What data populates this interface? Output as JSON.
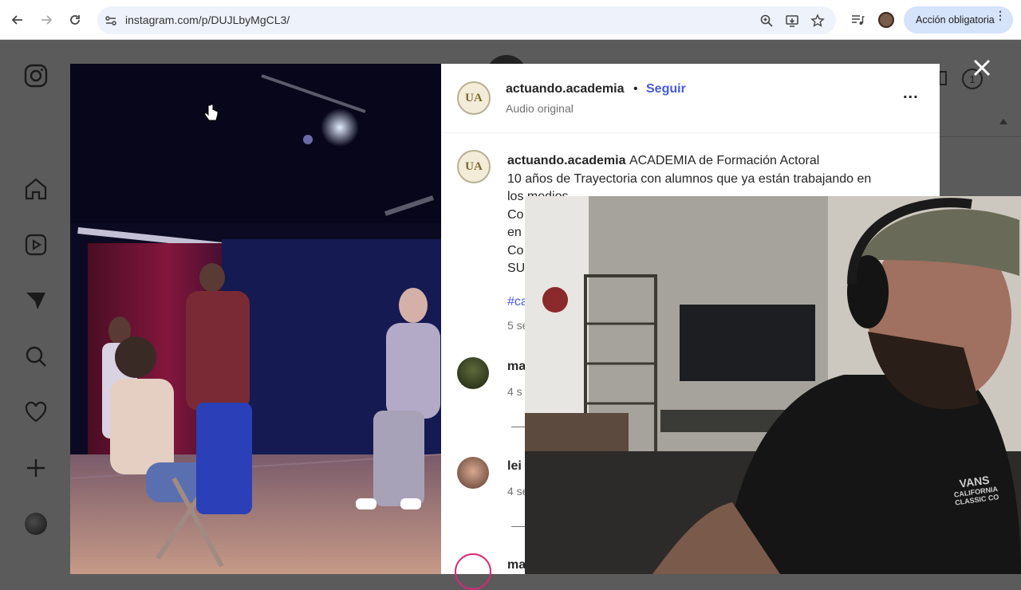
{
  "browser": {
    "url": "instagram.com/p/DUJLbyMgCL3/",
    "action_button": "Acción obligatoria"
  },
  "post": {
    "author": "actuando.academia",
    "separator": "•",
    "follow": "Seguir",
    "audio": "Audio original",
    "more": "...",
    "caption_author": "actuando.academia",
    "caption_line1": "ACADEMIA de Formación Actoral",
    "caption_line2": "10 años de Trayectoria con alumnos que ya están trabajando en",
    "caption_line3": "los medios",
    "caption_frag1": "Co",
    "caption_frag2": "en",
    "caption_frag3": "Co",
    "caption_frag4": "SU",
    "hashtag_frag": "#ca",
    "time_frag": "5 se",
    "avatar_initials": "UA"
  },
  "comments": [
    {
      "user_frag": "ma",
      "time_frag": "4 s"
    },
    {
      "user_frag": "lei",
      "time_frag": "4 se"
    },
    {
      "user_frag": "ma"
    }
  ],
  "webcam": {
    "shirt_text_1": "VANS",
    "shirt_text_2": "CALIFORNIA",
    "shirt_text_3": "CLASSIC CO"
  },
  "colors": {
    "follow_blue": "#4a5ae0",
    "dim_overlay": "#5b5b5b",
    "pill_blue": "#d5e3fb"
  }
}
